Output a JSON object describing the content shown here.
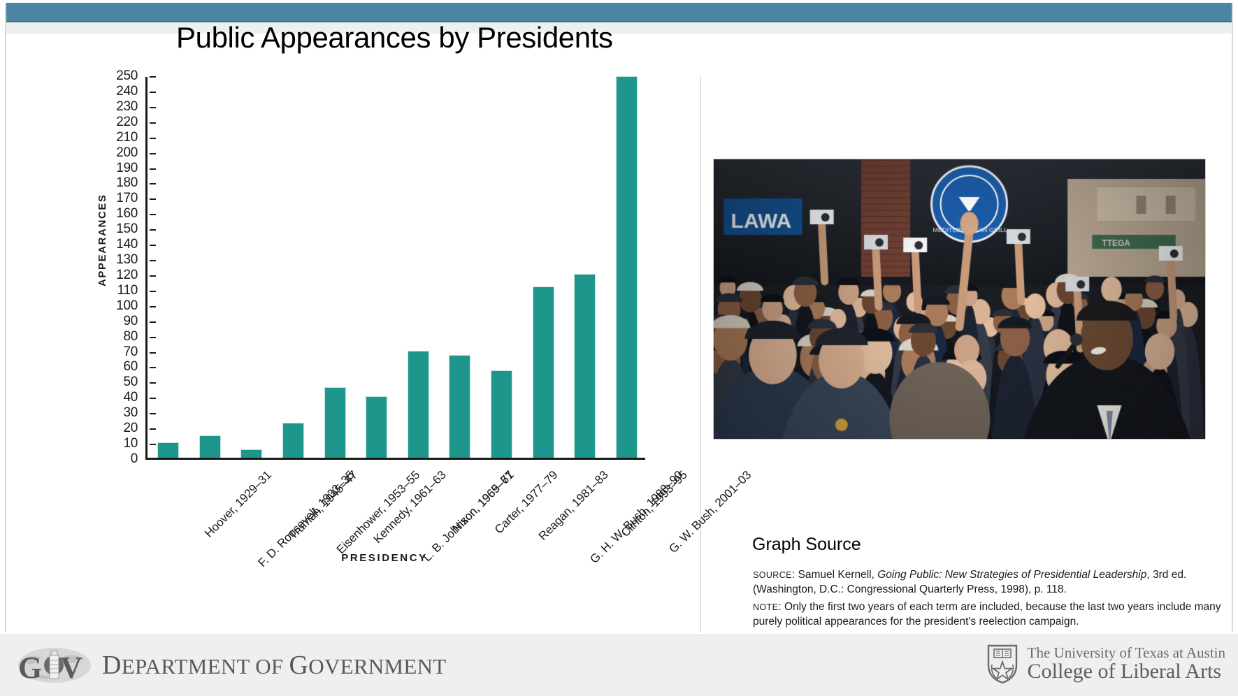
{
  "slide": {
    "title": "Public Appearances by Presidents",
    "accent_color": "#4a86a2",
    "bar_color": "#1f968c"
  },
  "chart_data": {
    "type": "bar",
    "title": "Public Appearances by Presidents",
    "xlabel": "PRESIDENCY",
    "ylabel": "APPEARANCES",
    "ylim": [
      0,
      250
    ],
    "ytick_step": 10,
    "grid": false,
    "legend": "none",
    "categories": [
      "Hoover, 1929–31",
      "F. D. Roosevelt, 1933–35",
      "Truman, 1945–47",
      "Eisenhower, 1953–55",
      "Kennedy, 1961–63",
      "L. B. Johnson, 1965–67",
      "Nixon, 1969–71",
      "Carter, 1977–79",
      "Reagan, 1981–83",
      "G. H. W. Bush, 1988–90",
      "Clinton, 1993–95",
      "G. W. Bush, 2001–03"
    ],
    "values": [
      10,
      14.5,
      5.5,
      23,
      46,
      40,
      70,
      67,
      57,
      112,
      120,
      249
    ],
    "ytick_labels": [
      "250",
      "240",
      "230",
      "220",
      "210",
      "200",
      "190",
      "180",
      "170",
      "160",
      "150",
      "140",
      "130",
      "120",
      "110",
      "100",
      "90",
      "80",
      "70",
      "60",
      "50",
      "40",
      "30",
      "20",
      "10",
      "0"
    ]
  },
  "right_panel": {
    "photo_alt": "Crowd of people photographing and reaching toward the president on a city street",
    "graph_source_heading": "Graph Source",
    "source_label": "SOURCE",
    "source_text_pre": ": Samuel Kernell, ",
    "source_title_italic": "Going Public: New Strategies of Presidential Leadership",
    "source_text_post": ", 3rd ed. (Washington, D.C.: Congressional Quarterly Press, 1998), p. 118.",
    "note_label": "NOTE",
    "note_text": ": Only the first two years of each term are included, because the last two years include many purely political appearances for the president's reelection campaign."
  },
  "footer": {
    "gov_mark_text": "GOV",
    "department_text_cap": "D",
    "department_text": "EPARTMENT OF ",
    "department_text_cap2": "G",
    "department_text2": "OVERNMENT",
    "ut_line1": "The University of Texas at Austin",
    "ut_line2": "College of Liberal Arts"
  }
}
